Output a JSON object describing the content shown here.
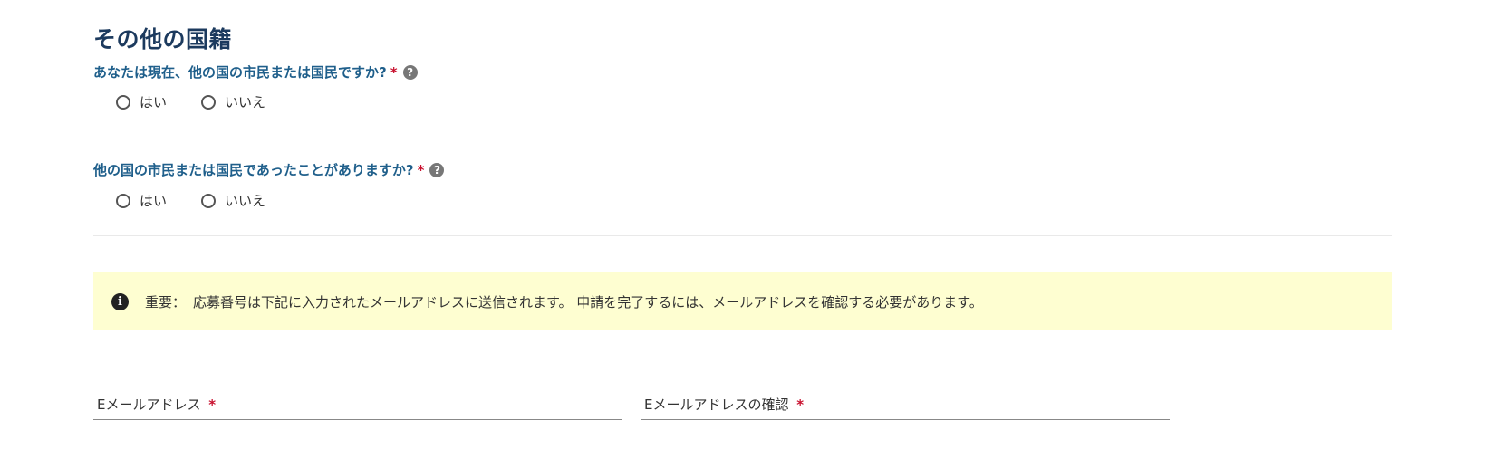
{
  "section": {
    "title": "その他の国籍"
  },
  "question1": {
    "label": "あなたは現在、他の国の市民または国民ですか?",
    "required_mark": "*",
    "options": [
      "はい",
      "いいえ"
    ]
  },
  "question2": {
    "label": "他の国の市民または国民であったことがありますか?",
    "required_mark": "*",
    "options": [
      "はい",
      "いいえ"
    ]
  },
  "notice": {
    "label": "重要：",
    "text": "応募番号は下記に入力されたメールアドレスに送信されます。 申請を完了するには、メールアドレスを確認する必要があります。",
    "icon": "info-circle-icon",
    "background": "#fefed1"
  },
  "email_field": {
    "label": "Eメールアドレス",
    "required_mark": "*"
  },
  "email_confirm_field": {
    "label": "Eメールアドレスの確認",
    "required_mark": "*"
  },
  "colors": {
    "title": "#1c3a5e",
    "question": "#1f5f8b",
    "required": "#c8102e"
  }
}
